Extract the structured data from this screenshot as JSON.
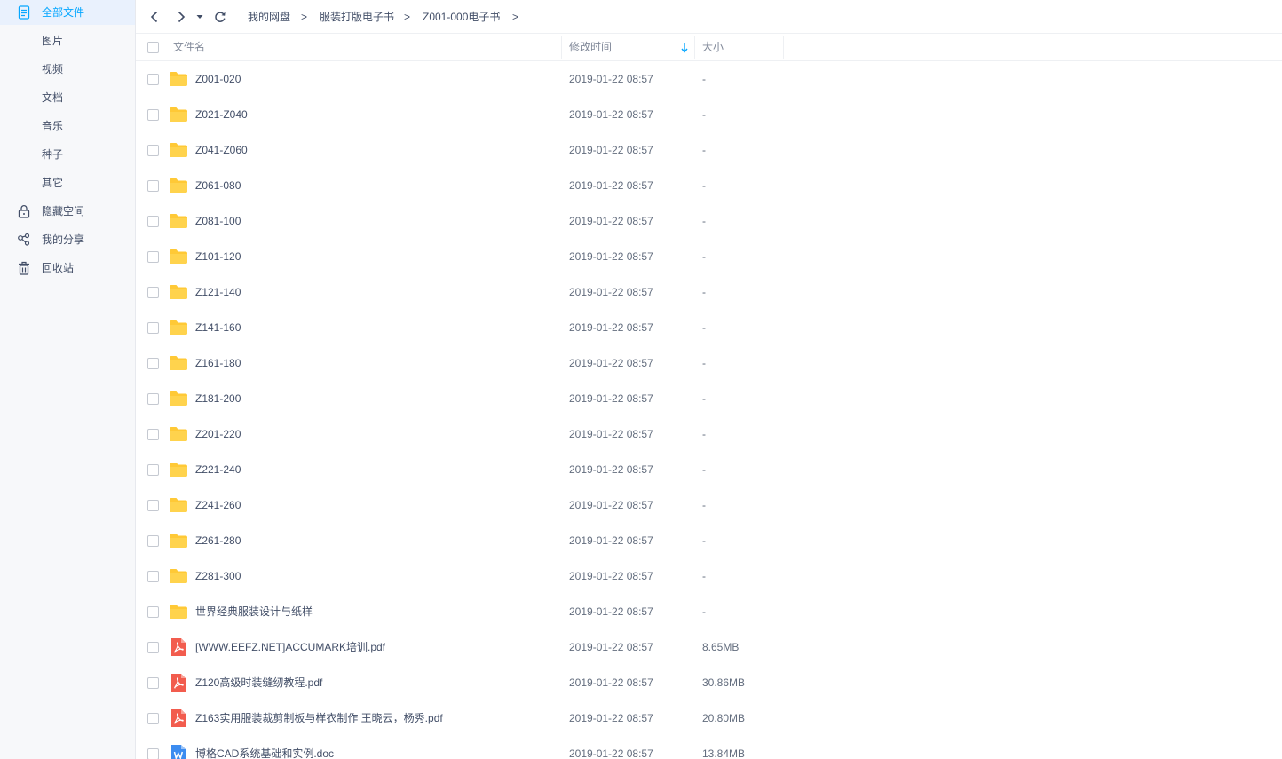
{
  "colors": {
    "accent": "#06a7ff",
    "folder": "#ffc936",
    "pdf": "#f25c4e",
    "doc": "#3c8cf0"
  },
  "sidebar": {
    "items": [
      {
        "label": "全部文件",
        "icon": "file-icon",
        "active": true
      },
      {
        "label": "图片",
        "icon": "",
        "active": false
      },
      {
        "label": "视频",
        "icon": "",
        "active": false
      },
      {
        "label": "文档",
        "icon": "",
        "active": false
      },
      {
        "label": "音乐",
        "icon": "",
        "active": false
      },
      {
        "label": "种子",
        "icon": "",
        "active": false
      },
      {
        "label": "其它",
        "icon": "",
        "active": false
      },
      {
        "label": "隐藏空间",
        "icon": "lock-icon",
        "active": false
      },
      {
        "label": "我的分享",
        "icon": "share-icon",
        "active": false
      },
      {
        "label": "回收站",
        "icon": "trash-icon",
        "active": false
      }
    ]
  },
  "nav": {
    "icons": [
      "back-icon",
      "forward-icon",
      "history-dropdown-icon",
      "refresh-icon"
    ],
    "breadcrumb": [
      "我的网盘",
      "服装打版电子书",
      "Z001-000电子书"
    ],
    "separator": ">"
  },
  "table": {
    "headers": {
      "name": "文件名",
      "modified": "修改时间",
      "size": "大小"
    },
    "sort": {
      "column": "modified",
      "direction": "desc"
    },
    "rows": [
      {
        "name": "Z001-020",
        "type": "folder",
        "modified": "2019-01-22 08:57",
        "size": "-"
      },
      {
        "name": "Z021-Z040",
        "type": "folder",
        "modified": "2019-01-22 08:57",
        "size": "-"
      },
      {
        "name": "Z041-Z060",
        "type": "folder",
        "modified": "2019-01-22 08:57",
        "size": "-"
      },
      {
        "name": "Z061-080",
        "type": "folder",
        "modified": "2019-01-22 08:57",
        "size": "-"
      },
      {
        "name": "Z081-100",
        "type": "folder",
        "modified": "2019-01-22 08:57",
        "size": "-"
      },
      {
        "name": "Z101-120",
        "type": "folder",
        "modified": "2019-01-22 08:57",
        "size": "-"
      },
      {
        "name": "Z121-140",
        "type": "folder",
        "modified": "2019-01-22 08:57",
        "size": "-"
      },
      {
        "name": "Z141-160",
        "type": "folder",
        "modified": "2019-01-22 08:57",
        "size": "-"
      },
      {
        "name": "Z161-180",
        "type": "folder",
        "modified": "2019-01-22 08:57",
        "size": "-"
      },
      {
        "name": "Z181-200",
        "type": "folder",
        "modified": "2019-01-22 08:57",
        "size": "-"
      },
      {
        "name": "Z201-220",
        "type": "folder",
        "modified": "2019-01-22 08:57",
        "size": "-"
      },
      {
        "name": "Z221-240",
        "type": "folder",
        "modified": "2019-01-22 08:57",
        "size": "-"
      },
      {
        "name": "Z241-260",
        "type": "folder",
        "modified": "2019-01-22 08:57",
        "size": "-"
      },
      {
        "name": "Z261-280",
        "type": "folder",
        "modified": "2019-01-22 08:57",
        "size": "-"
      },
      {
        "name": "Z281-300",
        "type": "folder",
        "modified": "2019-01-22 08:57",
        "size": "-"
      },
      {
        "name": "世界经典服装设计与纸样",
        "type": "folder",
        "modified": "2019-01-22 08:57",
        "size": "-"
      },
      {
        "name": "[WWW.EEFZ.NET]ACCUMARK培训.pdf",
        "type": "pdf",
        "modified": "2019-01-22 08:57",
        "size": "8.65MB"
      },
      {
        "name": "Z120高级时装缝纫教程.pdf",
        "type": "pdf",
        "modified": "2019-01-22 08:57",
        "size": "30.86MB"
      },
      {
        "name": "Z163实用服装裁剪制板与样衣制作 王晓云，杨秀.pdf",
        "type": "pdf",
        "modified": "2019-01-22 08:57",
        "size": "20.80MB"
      },
      {
        "name": "博格CAD系统基础和实例.doc",
        "type": "doc",
        "modified": "2019-01-22 08:57",
        "size": "13.84MB"
      }
    ]
  }
}
